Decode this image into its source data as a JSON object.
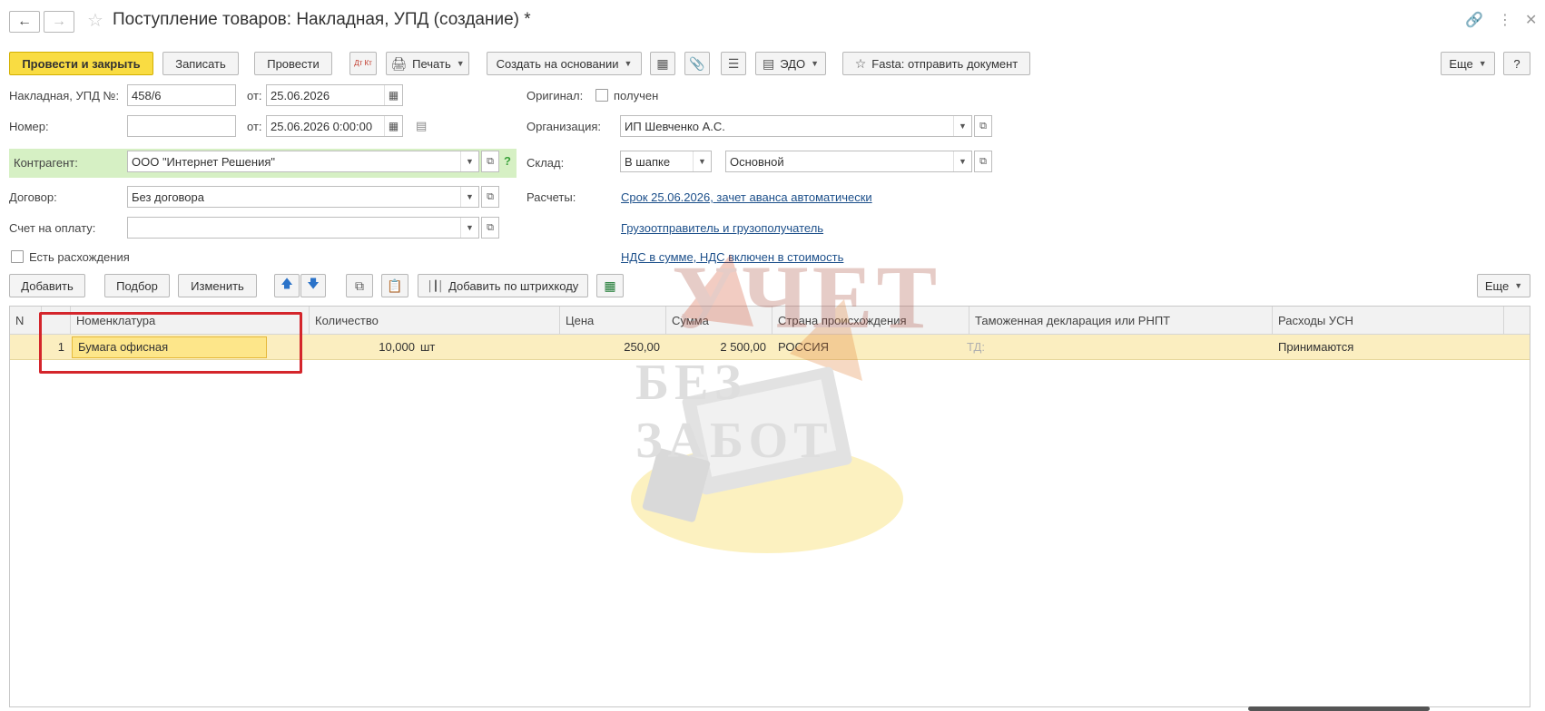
{
  "window": {
    "title": "Поступление товаров: Накладная, УПД (создание) *"
  },
  "toolbar": {
    "post_close": "Провести и закрыть",
    "save": "Записать",
    "post": "Провести",
    "dt_kt": "Дт Кт",
    "print": "Печать",
    "create_based": "Создать на основании",
    "edo": "ЭДО",
    "fasta": "Fasta: отправить документ",
    "more": "Еще",
    "help": "?"
  },
  "form": {
    "invoice_label": "Накладная, УПД №:",
    "invoice_number": "458/6",
    "from_label": "от:",
    "invoice_date": "25.06.2026",
    "number_label": "Номер:",
    "number_value": "",
    "number_datetime": "25.06.2026  0:00:00",
    "contractor_label": "Контрагент:",
    "contractor": "ООО \"Интернет Решения\"",
    "contract_label": "Договор:",
    "contract": "Без договора",
    "payment_label": "Счет на оплату:",
    "payment": "",
    "discrepancy_label": "Есть расхождения",
    "original_label": "Оригинал:",
    "original_received": "получен",
    "org_label": "Организация:",
    "org": "ИП Шевченко А.С.",
    "warehouse_label": "Склад:",
    "warehouse_mode": "В шапке",
    "warehouse": "Основной",
    "settlements_label": "Расчеты:",
    "settlements_link": "Срок 25.06.2026, зачет аванса автоматически",
    "shipper_link": "Грузоотправитель и грузополучатель",
    "vat_link": "НДС в сумме, НДС включен в стоимость"
  },
  "table_toolbar": {
    "add": "Добавить",
    "pick": "Подбор",
    "change": "Изменить",
    "add_barcode": "Добавить по штрихкоду",
    "more": "Еще"
  },
  "table": {
    "headers": {
      "n": "N",
      "nomenclature": "Номенклатура",
      "quantity": "Количество",
      "price": "Цена",
      "sum": "Сумма",
      "country": "Страна происхождения",
      "customs": "Таможенная декларация или РНПТ",
      "usn": "Расходы УСН"
    },
    "rows": [
      {
        "n": "1",
        "nomenclature": "Бумага офисная",
        "quantity": "10,000",
        "unit": "шт",
        "price": "250,00",
        "sum": "2 500,00",
        "country": "РОССИЯ",
        "customs": "ТД:",
        "usn": "Принимаются"
      }
    ]
  },
  "watermark": {
    "line1": "УЧЕТ",
    "line2": "БЕЗ ЗАБОТ"
  },
  "colors": {
    "primary": "#f9dc42",
    "link": "#1c4f8a",
    "highlight": "#d4252b",
    "contractor_bg": "#d6f0c4"
  }
}
